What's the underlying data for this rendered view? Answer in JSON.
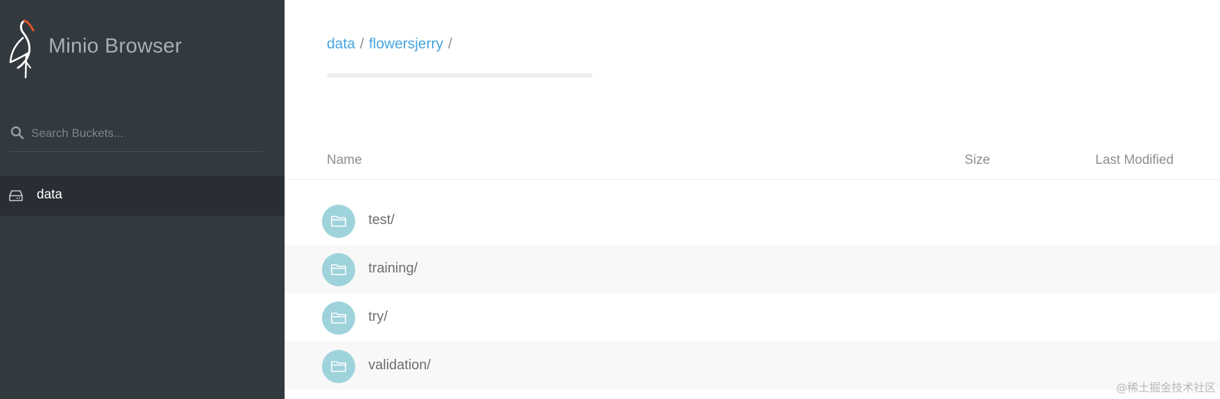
{
  "app": {
    "title": "Minio Browser"
  },
  "search": {
    "placeholder": "Search Buckets..."
  },
  "buckets": [
    {
      "label": "data"
    }
  ],
  "breadcrumb": {
    "items": [
      "data",
      "flowersjerry"
    ],
    "separator": "/"
  },
  "table": {
    "columns": {
      "name": "Name",
      "size": "Size",
      "modified": "Last Modified"
    },
    "rows": [
      {
        "name": "test/"
      },
      {
        "name": "training/"
      },
      {
        "name": "try/"
      },
      {
        "name": "validation/"
      }
    ]
  },
  "watermark": "@稀土掘金技术社区",
  "colors": {
    "sidebar_bg": "#32393f",
    "sidebar_active_bg": "#282e33",
    "link": "#46a5e0",
    "folder_badge": "#9fd3dc",
    "logo_accent": "#e2532b"
  },
  "icons": {
    "logo": "minio-bird-logo",
    "search": "search-icon",
    "bucket": "hard-drive-icon",
    "folder": "folder-icon"
  }
}
